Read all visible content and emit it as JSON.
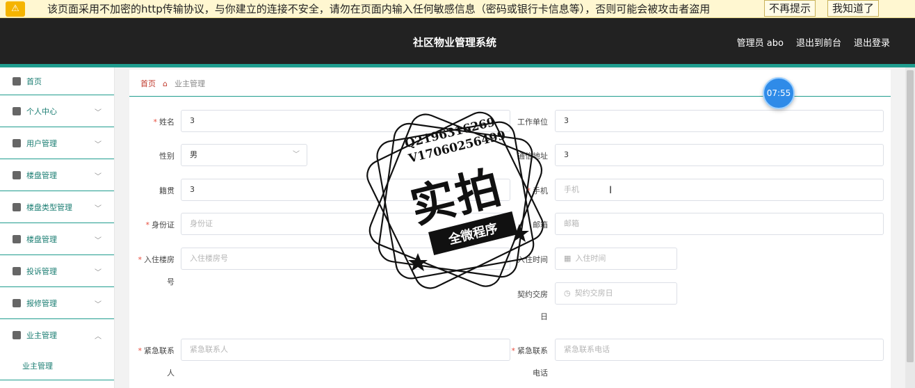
{
  "warning": {
    "text": "该页面采用不加密的http传输协议，与你建立的连接不安全，请勿在页面内输入任何敏感信息（密码或银行卡信息等），否则可能会被攻击者盗用",
    "btn_no_remind": "不再提示",
    "btn_got_it": "我知道了"
  },
  "header": {
    "title": "社区物业管理系统",
    "admin": "管理员 abo",
    "to_front": "退出到前台",
    "logout": "退出登录"
  },
  "sidebar": {
    "items": [
      {
        "label": "首页",
        "icon": "home-icon"
      },
      {
        "label": "个人中心",
        "icon": "user-icon"
      },
      {
        "label": "用户管理",
        "icon": "clipboard-icon"
      },
      {
        "label": "楼盘管理",
        "icon": "briefcase-icon"
      },
      {
        "label": "楼盘类型管理",
        "icon": "book-icon"
      },
      {
        "label": "楼盘管理",
        "icon": "clipboard-check-icon"
      },
      {
        "label": "投诉管理",
        "icon": "bar-chart-icon"
      },
      {
        "label": "报修管理",
        "icon": "message-icon"
      },
      {
        "label": "业主管理",
        "icon": "grid-icon"
      }
    ],
    "sub_item": "业主管理"
  },
  "breadcrumb": {
    "home": "首页",
    "current": "业主管理"
  },
  "clock": "07:55",
  "form": {
    "name_label": "姓名",
    "name_value": "3",
    "work_label": "工作单位",
    "work_value": "3",
    "gender_label": "性别",
    "gender_value": "男",
    "address_label": "通信地址",
    "address_value": "3",
    "native_label": "籍贯",
    "native_value": "3",
    "phone_label": "手机",
    "phone_placeholder": "手机",
    "id_label": "身份证",
    "id_placeholder": "身份证",
    "email_label": "邮箱",
    "email_placeholder": "邮箱",
    "room_label_1": "入住楼房",
    "room_label_2": "号",
    "room_placeholder": "入住楼房号",
    "checkin_label": "入住时间",
    "checkin_placeholder": "入住时间",
    "deliver_label_1": "契约交房",
    "deliver_label_2": "日",
    "deliver_placeholder": "契约交房日",
    "emerg_label_1": "紧急联系",
    "emerg_label_2": "人",
    "emerg_placeholder": "紧急联系人",
    "emerg_phone_label_1": "紧急联系",
    "emerg_phone_label_2": "电话",
    "emerg_phone_placeholder": "紧急联系电话"
  },
  "stamp": {
    "line1": "Q2196316269",
    "line2": "V17060256499",
    "big": "实拍",
    "banner": "全微程序"
  }
}
